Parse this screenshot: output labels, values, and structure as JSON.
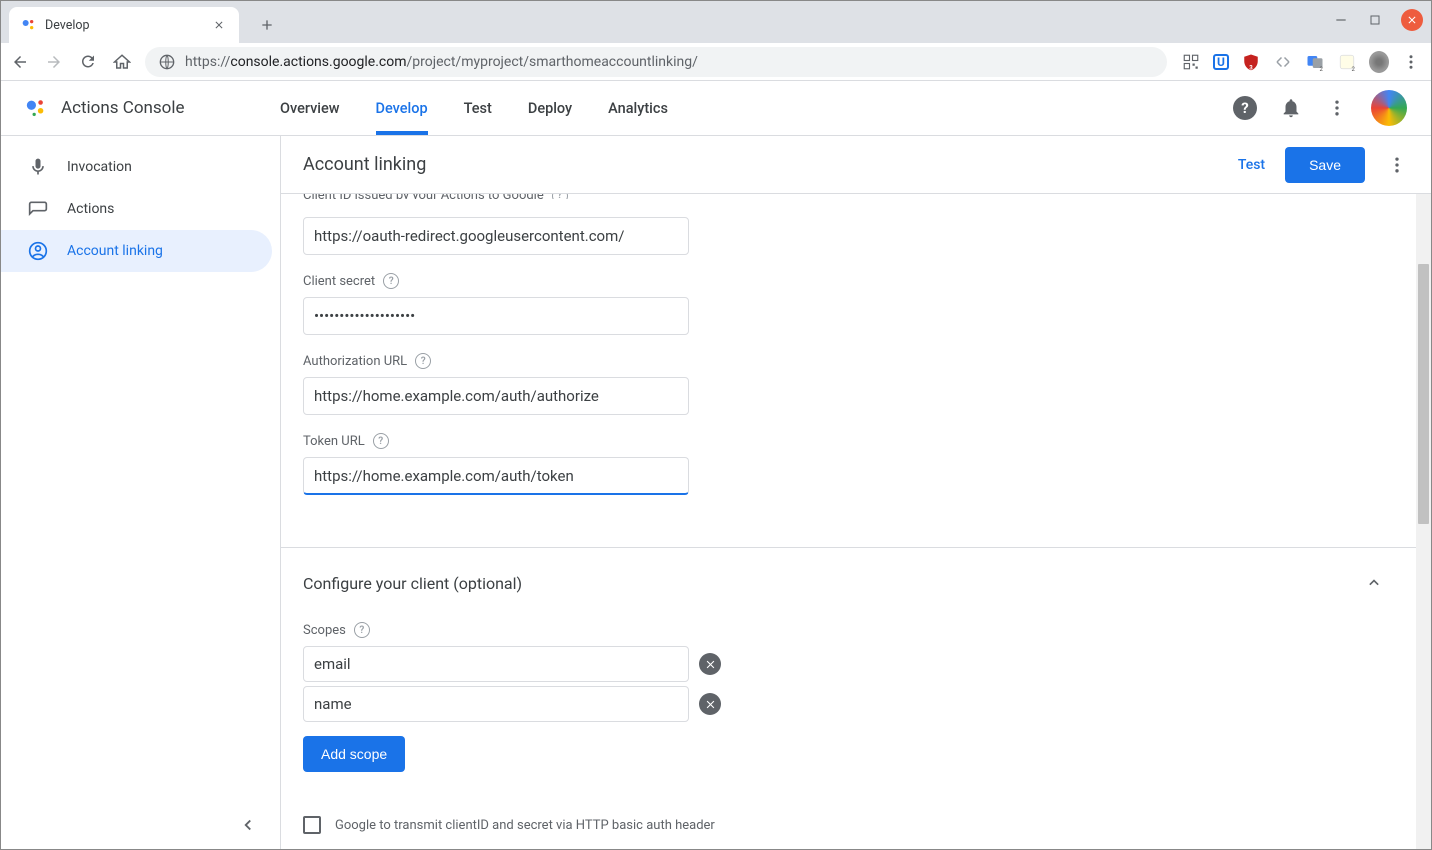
{
  "browser": {
    "tab_title": "Develop",
    "url_host": "console.actions.google.com",
    "url_path": "/project/myproject/smarthomeaccountlinking/"
  },
  "app": {
    "name": "Actions Console",
    "nav": {
      "overview": "Overview",
      "develop": "Develop",
      "test": "Test",
      "deploy": "Deploy",
      "analytics": "Analytics"
    }
  },
  "sidebar": {
    "invocation": "Invocation",
    "actions": "Actions",
    "account_linking": "Account linking"
  },
  "page": {
    "title": "Account linking",
    "test_label": "Test",
    "save_label": "Save"
  },
  "form": {
    "client_id_cutoff": "Client ID issued by your Actions to Google",
    "client_id_value": "https://oauth-redirect.googleusercontent.com/",
    "client_secret_label": "Client secret",
    "client_secret_value": "••••••••••••••••••••",
    "auth_url_label": "Authorization URL",
    "auth_url_value": "https://home.example.com/auth/authorize",
    "token_url_label": "Token URL",
    "token_url_value": "https://home.example.com/auth/token"
  },
  "section2": {
    "title": "Configure your client (optional)",
    "scopes_label": "Scopes",
    "scope1": "email",
    "scope2": "name",
    "add_scope": "Add scope",
    "checkbox_label": "Google to transmit clientID and secret via HTTP basic auth header"
  }
}
